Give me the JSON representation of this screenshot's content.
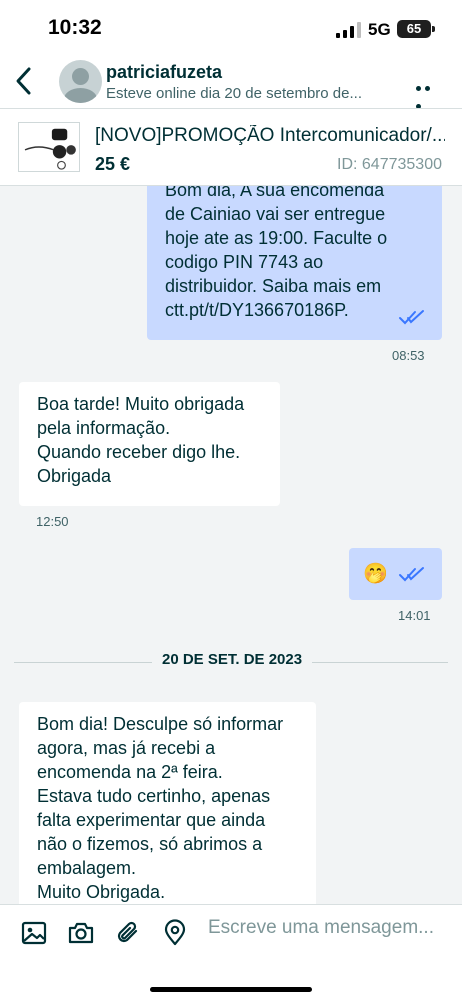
{
  "status_bar": {
    "time": "10:32",
    "network": "5G",
    "battery": "65"
  },
  "header": {
    "back_icon": "chevron-left-icon",
    "contact_name": "patriciafuzeta",
    "contact_status": "Esteve online dia 20 de setembro de...",
    "more_icon": "more-horizontal-icon"
  },
  "product": {
    "title": "[NOVO]PROMOÇÃO Intercomunicador/...",
    "price": "25 €",
    "id": "ID: 647735300"
  },
  "messages": [
    {
      "direction": "outgoing",
      "lines": [
        "Bom dia, A sua encomenda",
        "de Cainiao vai ser entregue",
        "hoje ate as 19:00. Faculte o",
        "codigo PIN 7743 ao",
        "distribuidor.  Saiba mais em",
        "ctt.pt/t/DY136670186P."
      ],
      "time": "08:53",
      "read": true
    },
    {
      "direction": "incoming",
      "lines": [
        "Boa tarde! Muito obrigada",
        "pela informação.",
        "Quando receber digo lhe.",
        "Obrigada"
      ],
      "time": "12:50"
    },
    {
      "direction": "outgoing",
      "lines": [
        "🤭"
      ],
      "time": "14:01",
      "read": true
    },
    {
      "direction": "incoming",
      "lines": [
        "Bom dia! Desculpe só informar",
        "agora, mas já recebi a",
        "encomenda na 2ª feira.",
        "Estava tudo certinho, apenas",
        "falta experimentar que ainda",
        "não o fizemos, só abrimos a",
        "embalagem.",
        "Muito Obrigada."
      ]
    }
  ],
  "date_separator": "20 DE SET. DE 2023",
  "composer": {
    "placeholder": "Escreve uma mensagem...",
    "icons": [
      "image-icon",
      "camera-icon",
      "paperclip-icon",
      "location-pin-icon"
    ]
  },
  "colors": {
    "outgoing_bubble": "#c8d9ff",
    "incoming_bubble": "#ffffff",
    "read_ticks": "#3a77ff",
    "text": "#002f34",
    "background": "#f2f4f5"
  }
}
